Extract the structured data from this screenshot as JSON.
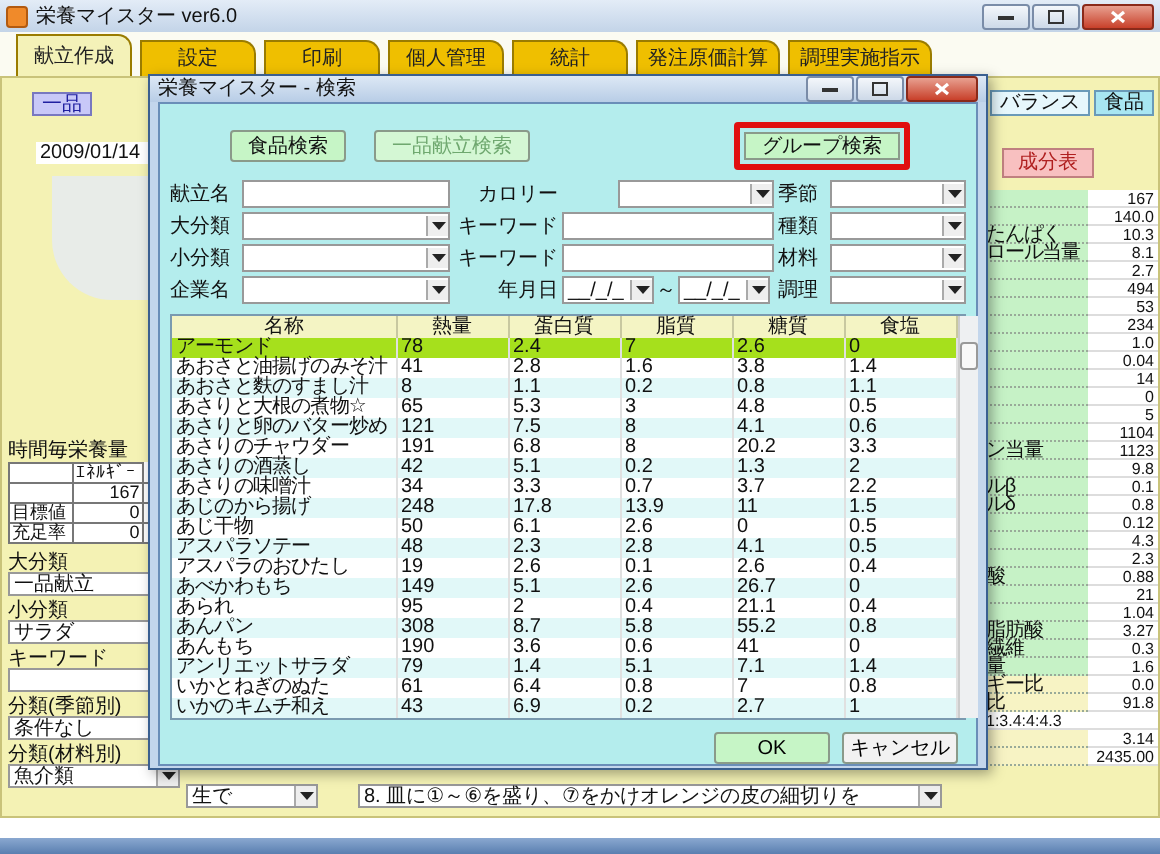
{
  "window": {
    "title": "栄養マイスター ver6.0"
  },
  "tabs": [
    {
      "label": "献立作成",
      "selected": true
    },
    {
      "label": "設定",
      "selected": false
    },
    {
      "label": "印刷",
      "selected": false
    },
    {
      "label": "個人管理",
      "selected": false
    },
    {
      "label": "統計",
      "selected": false
    },
    {
      "label": "発注原価計算",
      "selected": false
    },
    {
      "label": "調理実施指示",
      "selected": false
    }
  ],
  "left_panel": {
    "button": "一品",
    "date": "2009/01/14",
    "nutrition_heading": "時間毎栄養量",
    "nutrition_table": {
      "header": [
        "ｴﾈﾙｷﾞｰ"
      ],
      "rows": [
        {
          "value": "167"
        },
        {
          "label": "目標値",
          "value": "0"
        },
        {
          "label": "充足率",
          "value": "0"
        }
      ]
    },
    "fields": [
      {
        "label": "大分類",
        "kind": "text",
        "value": "一品献立"
      },
      {
        "label": "小分類",
        "kind": "text",
        "value": "サラダ"
      },
      {
        "label": "キーワード",
        "kind": "text"
      },
      {
        "label": "分類(季節別)",
        "kind": "text",
        "value": "条件なし"
      },
      {
        "label": "分類(材料別)",
        "kind": "select",
        "value": "魚介類"
      }
    ]
  },
  "bottom_row": {
    "method_value": "生で",
    "instruction_line": "8. 皿に①～⑥を盛り、⑦をかけオレンジの皮の細切りを"
  },
  "right_panel": {
    "tabs": [
      {
        "label": "バランス",
        "selected": true
      },
      {
        "label": "食品",
        "selected": false
      }
    ],
    "button": "成分表",
    "rows": [
      {
        "kind": "nutrient",
        "value": "167"
      },
      {
        "kind": "nutrient",
        "value": "140.0"
      },
      {
        "kind": "nutrient",
        "label": "たんぱく",
        "value": "10.3"
      },
      {
        "kind": "nutrient",
        "label": "ロール当量",
        "value": "8.1"
      },
      {
        "kind": "nutrient",
        "value": "2.7"
      },
      {
        "kind": "nutrient",
        "value": "494"
      },
      {
        "kind": "nutrient",
        "value": "53"
      },
      {
        "kind": "nutrient",
        "value": "234"
      },
      {
        "kind": "nutrient",
        "value": "1.0"
      },
      {
        "kind": "nutrient",
        "value": "0.04"
      },
      {
        "kind": "nutrient",
        "value": "14"
      },
      {
        "kind": "nutrient",
        "value": "0"
      },
      {
        "kind": "nutrient",
        "value": "5"
      },
      {
        "kind": "nutrient",
        "value": "1104"
      },
      {
        "kind": "nutrient",
        "label": "ン当量",
        "value": "1123"
      },
      {
        "kind": "nutrient",
        "value": "9.8"
      },
      {
        "kind": "nutrient",
        "label": "ルβ",
        "value": "0.1"
      },
      {
        "kind": "nutrient",
        "label": "ルδ",
        "value": "0.8"
      },
      {
        "kind": "nutrient",
        "value": "0.12"
      },
      {
        "kind": "nutrient",
        "value": "4.3"
      },
      {
        "kind": "nutrient",
        "value": "2.3"
      },
      {
        "kind": "nutrient",
        "label": "酸",
        "value": "0.88"
      },
      {
        "kind": "nutrient",
        "value": "21"
      },
      {
        "kind": "nutrient",
        "value": "1.04"
      },
      {
        "kind": "nutrient",
        "label": "脂肪酸",
        "value": "3.27"
      },
      {
        "kind": "nutrient",
        "label": "繊維",
        "value": "0.3"
      },
      {
        "kind": "nutrient",
        "label": "量",
        "value": "1.6"
      },
      {
        "kind": "ratio",
        "label": "ギー比",
        "value": "0.0"
      },
      {
        "kind": "ratio",
        "label": "比",
        "value": "91.8"
      },
      {
        "kind": "wide",
        "value": "1:3.4:4:4.3"
      },
      {
        "kind": "ratio",
        "value": "3.14"
      },
      {
        "kind": "ratio",
        "value": "2435.00"
      }
    ]
  },
  "dialog": {
    "title": "栄養マイスター - 検索",
    "search_buttons": [
      {
        "label": "食品検索",
        "disabled": false,
        "highlighted": false
      },
      {
        "label": "一品献立検索",
        "disabled": true,
        "highlighted": false
      },
      {
        "label": "グループ検索",
        "disabled": false,
        "highlighted": true
      }
    ],
    "form": [
      [
        {
          "label": "献立名",
          "kind": "text"
        },
        {
          "label": "カロリー",
          "kind": "select"
        },
        {
          "label": "季節",
          "kind": "select"
        }
      ],
      [
        {
          "label": "大分類",
          "kind": "select"
        },
        {
          "label": "キーワード",
          "kind": "text"
        },
        {
          "label": "種類",
          "kind": "select"
        }
      ],
      [
        {
          "label": "小分類",
          "kind": "select"
        },
        {
          "label": "キーワード",
          "kind": "text"
        },
        {
          "label": "材料",
          "kind": "select"
        }
      ],
      [
        {
          "label": "企業名",
          "kind": "select"
        },
        {
          "label": "年月日",
          "kind": "date_range",
          "from": "__/_/_",
          "separator": "～",
          "to": "__/_/_"
        },
        {
          "label": "調理",
          "kind": "select"
        }
      ]
    ],
    "table": {
      "columns": [
        "名称",
        "熱量",
        "蛋白質",
        "脂質",
        "糖質",
        "食塩"
      ],
      "rows": [
        {
          "selected": true,
          "cells": [
            "アーモンド",
            "78",
            "2.4",
            "7",
            "2.6",
            "0"
          ]
        },
        {
          "selected": false,
          "cells": [
            "あおさと油揚げのみそ汁",
            "41",
            "2.8",
            "1.6",
            "3.8",
            "1.4"
          ]
        },
        {
          "selected": false,
          "cells": [
            "あおさと麩のすまし汁",
            "8",
            "1.1",
            "0.2",
            "0.8",
            "1.1"
          ]
        },
        {
          "selected": false,
          "cells": [
            "あさりと大根の煮物☆",
            "65",
            "5.3",
            "3",
            "4.8",
            "0.5"
          ]
        },
        {
          "selected": false,
          "cells": [
            "あさりと卵のバター炒め",
            "121",
            "7.5",
            "8",
            "4.1",
            "0.6"
          ]
        },
        {
          "selected": false,
          "cells": [
            "あさりのチャウダー",
            "191",
            "6.8",
            "8",
            "20.2",
            "3.3"
          ]
        },
        {
          "selected": false,
          "cells": [
            "あさりの酒蒸し",
            "42",
            "5.1",
            "0.2",
            "1.3",
            "2"
          ]
        },
        {
          "selected": false,
          "cells": [
            "あさりの味噌汁",
            "34",
            "3.3",
            "0.7",
            "3.7",
            "2.2"
          ]
        },
        {
          "selected": false,
          "cells": [
            "あじのから揚げ",
            "248",
            "17.8",
            "13.9",
            "11",
            "1.5"
          ]
        },
        {
          "selected": false,
          "cells": [
            "あじ干物",
            "50",
            "6.1",
            "2.6",
            "0",
            "0.5"
          ]
        },
        {
          "selected": false,
          "cells": [
            "アスパラソテー",
            "48",
            "2.3",
            "2.8",
            "4.1",
            "0.5"
          ]
        },
        {
          "selected": false,
          "cells": [
            "アスパラのおひたし",
            "19",
            "2.6",
            "0.1",
            "2.6",
            "0.4"
          ]
        },
        {
          "selected": false,
          "cells": [
            "あべかわもち",
            "149",
            "5.1",
            "2.6",
            "26.7",
            "0"
          ]
        },
        {
          "selected": false,
          "cells": [
            "あられ",
            "95",
            "2",
            "0.4",
            "21.1",
            "0.4"
          ]
        },
        {
          "selected": false,
          "cells": [
            "あんパン",
            "308",
            "8.7",
            "5.8",
            "55.2",
            "0.8"
          ]
        },
        {
          "selected": false,
          "cells": [
            "あんもち",
            "190",
            "3.6",
            "0.6",
            "41",
            "0"
          ]
        },
        {
          "selected": false,
          "cells": [
            "アンリエットサラダ",
            "79",
            "1.4",
            "5.1",
            "7.1",
            "1.4"
          ]
        },
        {
          "selected": false,
          "cells": [
            "いかとねぎのぬた",
            "61",
            "6.4",
            "0.8",
            "7",
            "0.8"
          ]
        },
        {
          "selected": false,
          "cells": [
            "いかのキムチ和え",
            "43",
            "6.9",
            "0.2",
            "2.7",
            "1"
          ]
        }
      ]
    },
    "buttons": [
      {
        "label": "OK",
        "kind": "primary"
      },
      {
        "label": "キャンセル",
        "kind": "secondary"
      }
    ]
  }
}
